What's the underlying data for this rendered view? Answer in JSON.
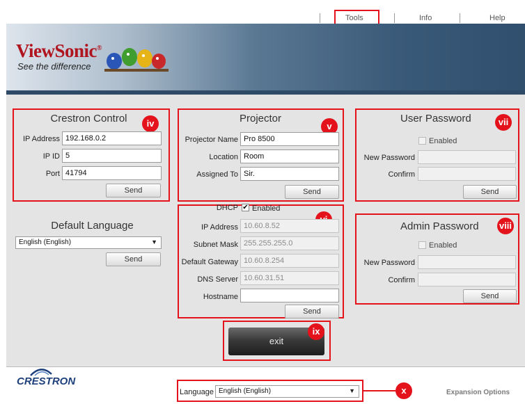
{
  "nav": {
    "tools": "Tools",
    "info": "Info",
    "help": "Help"
  },
  "banner": {
    "logo": "ViewSonic",
    "trademark": "®",
    "tagline": "See the difference"
  },
  "crestron_control": {
    "title": "Crestron Control",
    "badge": "iv",
    "ip_address_label": "IP Address",
    "ip_address": "192.168.0.2",
    "ip_id_label": "IP ID",
    "ip_id": "5",
    "port_label": "Port",
    "port": "41794",
    "send": "Send"
  },
  "projector": {
    "title": "Projector",
    "badge": "v",
    "name_label": "Projector Name",
    "name": "Pro 8500",
    "location_label": "Location",
    "location": "Room",
    "assigned_label": "Assigned To",
    "assigned": "Sir.",
    "send": "Send"
  },
  "network": {
    "badge": "vi",
    "dhcp_label": "DHCP",
    "dhcp_enabled": "Enabled",
    "ip_address_label": "IP Address",
    "ip_address": "10.60.8.52",
    "subnet_label": "Subnet Mask",
    "subnet": "255.255.255.0",
    "gateway_label": "Default Gateway",
    "gateway": "10.60.8.254",
    "dns_label": "DNS Server",
    "dns": "10.60.31.51",
    "hostname_label": "Hostname",
    "hostname": "",
    "send": "Send"
  },
  "user_password": {
    "title": "User Password",
    "badge": "vii",
    "enabled": "Enabled",
    "new_label": "New Password",
    "confirm_label": "Confirm",
    "send": "Send"
  },
  "admin_password": {
    "title": "Admin Password",
    "badge": "viii",
    "enabled": "Enabled",
    "new_label": "New Password",
    "confirm_label": "Confirm",
    "send": "Send"
  },
  "default_language": {
    "title": "Default Language",
    "selected": "English (English)",
    "send": "Send"
  },
  "exit": {
    "label": "exit",
    "badge": "ix"
  },
  "footer": {
    "crestron": "CRESTRON",
    "language_label": "Language",
    "language_selected": "English (English)",
    "badge": "x",
    "expansion": "Expansion Options"
  },
  "colors": {
    "highlight_red": "#e3121b",
    "banner_dark": "#304f6e"
  }
}
